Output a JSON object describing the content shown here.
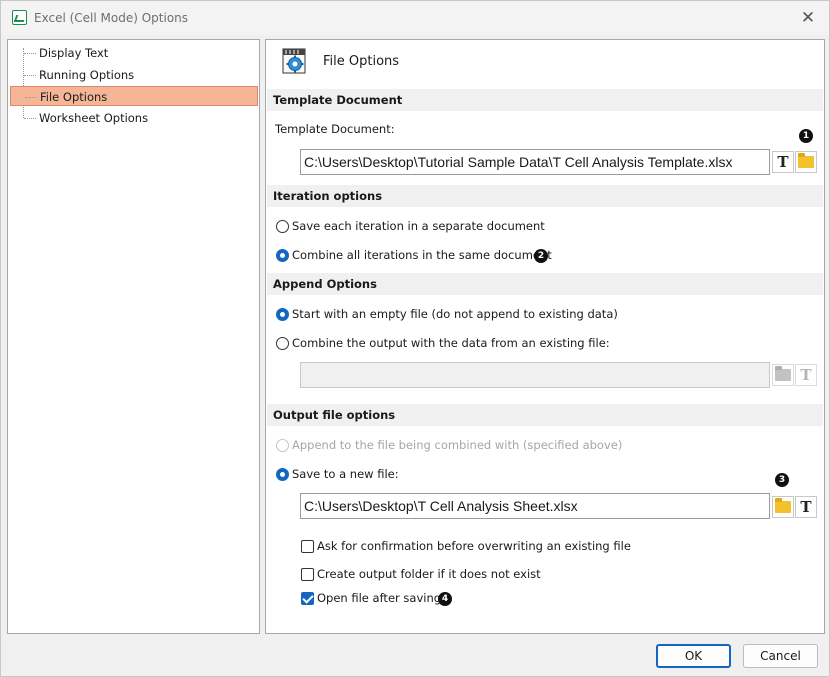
{
  "window": {
    "title": "Excel (Cell Mode) Options"
  },
  "tree": {
    "items": [
      {
        "label": "Display Text",
        "selected": false
      },
      {
        "label": "Running Options",
        "selected": false
      },
      {
        "label": "File Options",
        "selected": true
      },
      {
        "label": "Worksheet Options",
        "selected": false
      }
    ]
  },
  "panel": {
    "title": "File Options"
  },
  "template": {
    "section": "Template Document",
    "field_label": "Template Document:",
    "path": "C:\\Users\\Desktop\\Tutorial Sample Data\\T Cell Analysis Template.xlsx",
    "badge": "1"
  },
  "iteration": {
    "section": "Iteration options",
    "separate": "Save each iteration in a separate document",
    "combine": "Combine all iterations in the same document",
    "selected": "combine",
    "badge": "2"
  },
  "append": {
    "section": "Append Options",
    "empty": "Start with an empty file (do not append to existing data)",
    "combine_existing": "Combine the output with the data from an existing file:",
    "selected": "empty",
    "existing_path": ""
  },
  "output": {
    "section": "Output file options",
    "append_combined": "Append to the file being combined with (specified above)",
    "save_new": "Save to a new file:",
    "selected": "save_new",
    "path": "C:\\Users\\Desktop\\T Cell Analysis Sheet.xlsx",
    "badge_path": "3",
    "ask_confirm": {
      "label": "Ask for confirmation before overwriting an existing file",
      "checked": false
    },
    "create_folder": {
      "label": "Create output folder if it does not exist",
      "checked": false
    },
    "open_after": {
      "label": "Open file after saving",
      "checked": true
    },
    "badge_open": "4"
  },
  "buttons": {
    "ok": "OK",
    "cancel": "Cancel"
  },
  "icons": {
    "text_format": "T",
    "folder": "folder-icon",
    "close": "✕"
  },
  "colors": {
    "selection_bg": "#f5b597",
    "accent": "#1466c0"
  }
}
